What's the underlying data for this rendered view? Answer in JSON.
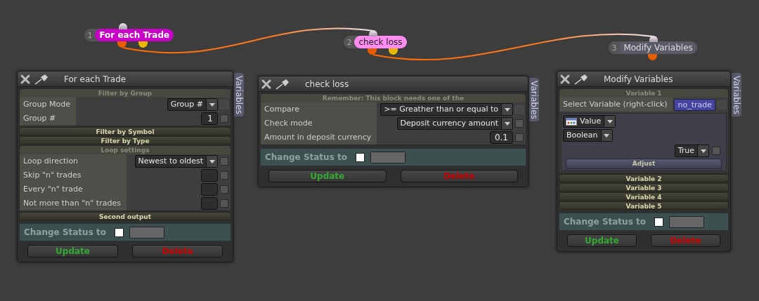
{
  "nodes": [
    {
      "number": "1",
      "label": "For each Trade",
      "color": "#c800c8"
    },
    {
      "number": "2",
      "label": "check loss",
      "color": "#ff8cf0"
    },
    {
      "number": "3",
      "label": "Modify Variables",
      "color": "#5a5a66"
    }
  ],
  "panels": [
    {
      "title": "For each Trade",
      "side_tab": "Variables",
      "sections": [
        {
          "header": "Filter by Group",
          "expanded": true,
          "rows": [
            {
              "kind": "dropdown",
              "label": "Group Mode",
              "value": "Group #",
              "checkbox_disabled": true
            },
            {
              "kind": "number",
              "label": "Group #",
              "value": "1",
              "checkbox_disabled": false
            }
          ]
        },
        {
          "header": "Filter by Symbol",
          "expanded": false
        },
        {
          "header": "Filter by Type",
          "expanded": false
        },
        {
          "header": "Loop settings",
          "expanded": true,
          "rows": [
            {
              "kind": "dropdown",
              "label": "Loop direction",
              "value": "Newest to oldest",
              "checkbox_disabled": false
            },
            {
              "kind": "blank",
              "label": "Skip \"n\" trades",
              "checkbox_disabled": false
            },
            {
              "kind": "blank",
              "label": "Every \"n\" trade",
              "checkbox_disabled": false
            },
            {
              "kind": "blank",
              "label": "Not more than \"n\" trades",
              "checkbox_disabled": false
            }
          ]
        },
        {
          "header": "Second output",
          "expanded": false
        }
      ],
      "status": {
        "label": "Change Status to",
        "checked": false
      },
      "buttons": [
        "Update",
        "Delete"
      ]
    },
    {
      "title": "check loss",
      "side_tab": "Variables",
      "sections": [
        {
          "header": "Remember: This block needs one of the",
          "expanded": true,
          "rows": [
            {
              "kind": "dropdown",
              "label": "Compare",
              "value": ">= Greather than or equal to",
              "checkbox_disabled": true
            },
            {
              "kind": "dropdown",
              "label": "Check mode",
              "value": "Deposit currency amount",
              "checkbox_disabled": false
            },
            {
              "kind": "number",
              "label": "Amount in deposit currency",
              "value": "0.1",
              "checkbox_disabled": false
            }
          ]
        }
      ],
      "status": {
        "label": "Change Status to",
        "checked": false
      },
      "buttons": [
        "Update",
        "Delete"
      ]
    },
    {
      "title": "Modify Variables",
      "side_tab": "Variables",
      "sections": [
        {
          "header": "Variable 1",
          "expanded": true,
          "rows": [
            {
              "kind": "variable",
              "label": "Select Variable (right-click)",
              "value": "no_trade",
              "checkbox_disabled": true
            },
            {
              "kind": "editor",
              "source": "Value",
              "data_type": "Boolean",
              "value": "True",
              "action": "Adjust",
              "checkbox_disabled": false
            }
          ]
        },
        {
          "header": "Variable 2",
          "expanded": false
        },
        {
          "header": "Variable 3",
          "expanded": false
        },
        {
          "header": "Variable 4",
          "expanded": false
        },
        {
          "header": "Variable 5",
          "expanded": false
        }
      ],
      "status": {
        "label": "Change Status to",
        "checked": false
      },
      "buttons": [
        "Update",
        "Delete"
      ]
    }
  ]
}
